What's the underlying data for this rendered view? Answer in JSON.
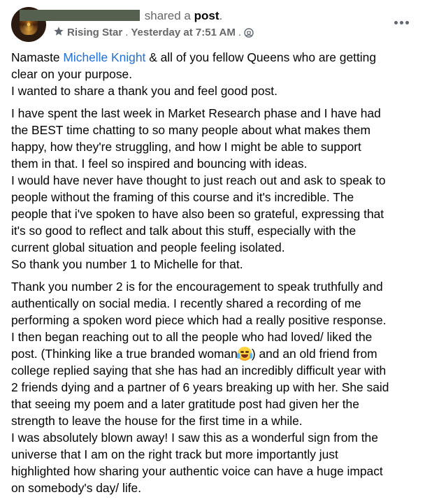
{
  "header": {
    "verb": "shared a",
    "object": "post",
    "period": ".",
    "badge": "Rising Star",
    "separator": ".",
    "timestamp": "Yesterday at 7:51 AM",
    "separator2": ".",
    "privacy_icon": "globe-icon",
    "more_icon": "more-options-icon"
  },
  "body": {
    "p1": {
      "l1_prefix": "Namaste ",
      "mention": "Michelle Knight",
      "l1_suffix": " & all of you fellow Queens who are getting",
      "l2": "clear on your purpose.",
      "l3": "I wanted to share a thank you and feel good post."
    },
    "p2": [
      "I have spent the last week in Market Research phase and I have had",
      "the BEST time chatting to so many people about what makes them",
      "happy, how they're struggling, and how I might be able to support",
      "them in that. I feel so inspired and bouncing with ideas.",
      "I would have never have thought to just reach out and ask to speak to",
      "people without the framing of this course and it's incredible. The",
      "people that i've spoken to have also been so grateful, expressing that",
      "it's so good to reflect and talk about this stuff, especially with the",
      "current global situation and people feeling isolated.",
      "So thank you number 1 to Michelle for that."
    ],
    "p3": {
      "l1": "Thank you number 2 is for the encouragement to speak truthfully and",
      "l2": "authentically on social media. I recently shared a recording of me",
      "l3": "performing  a spoken word piece which had a really positive response.",
      "l4": "I then began reaching out to all the people who had loved/ liked the",
      "l5_prefix": "post. (Thinking like a true branded woman",
      "l5_suffix": ") and an old friend from",
      "l6": "college replied saying that she has had an incredibly difficult year with",
      "l7": "2 friends dying and a partner of 6 years breaking up with her. She said",
      "l8": "that seeing my poem and a later gratitude post had given her the",
      "l9": "strength to leave the house for the first time in a while.",
      "l10": "I was absolutely blown away! I saw this as a wonderful sign from the",
      "l11": "universe that I am on the right track but more importantly just",
      "l12": "highlighted how sharing your authentic voice can have a huge impact",
      "l13": "on somebody's day/ life.",
      "emoji": "tears-of-joy-emoji"
    }
  },
  "colors": {
    "mention": "#216fdb",
    "meta_text": "#65676b",
    "body_text": "#050505"
  }
}
